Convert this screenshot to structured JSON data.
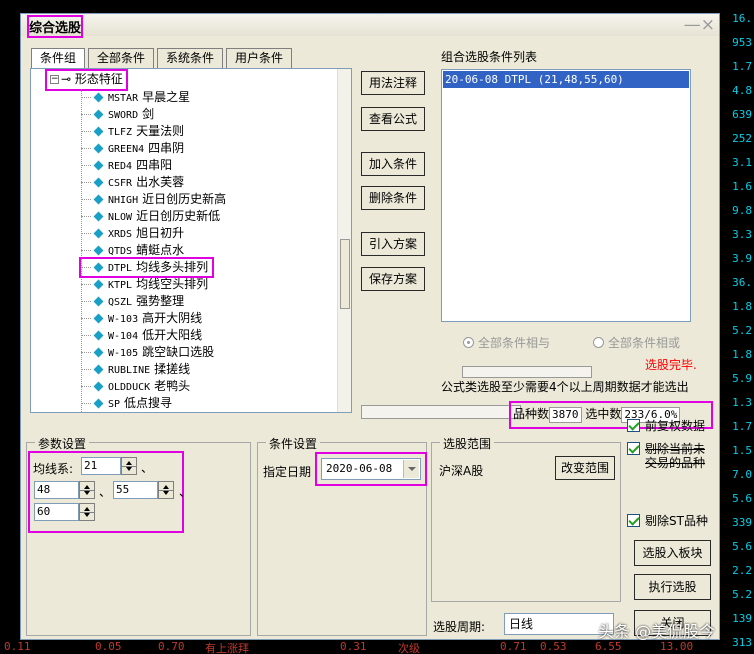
{
  "background": {
    "right_column": [
      "16.",
      "953",
      "1.7",
      "4.8",
      "639",
      "252",
      "3.1",
      "1.6",
      "9.8",
      "3.3",
      "3.9",
      "36.",
      "1.8",
      "5.2",
      "1.8",
      "5.9",
      "1.3",
      "1.7",
      "1.5",
      "7.0",
      "5.6",
      "339",
      "5.6",
      "2.2",
      "5.2",
      "139",
      "313"
    ],
    "bottom_row": [
      "0.11",
      "0.05",
      "0.70",
      "有上涨拜",
      "0.31",
      "次级",
      "0.71",
      "0.53",
      "6.55",
      "13.00"
    ]
  },
  "window": {
    "title": "综合选股",
    "close": "—×"
  },
  "tabs": [
    "条件组",
    "全部条件",
    "系统条件",
    "用户条件"
  ],
  "tree": {
    "root": "形态特征",
    "items": [
      {
        "code": "MSTAR",
        "label": "早晨之星"
      },
      {
        "code": "SWORD",
        "label": "剑"
      },
      {
        "code": "TLFZ",
        "label": "天量法则"
      },
      {
        "code": "GREEN4",
        "label": "四串阴"
      },
      {
        "code": "RED4",
        "label": "四串阳"
      },
      {
        "code": "CSFR",
        "label": "出水芙蓉"
      },
      {
        "code": "NHIGH",
        "label": "近日创历史新高"
      },
      {
        "code": "NLOW",
        "label": "近日创历史新低"
      },
      {
        "code": "XRDS",
        "label": "旭日初升"
      },
      {
        "code": "QTDS",
        "label": "蜻蜓点水"
      },
      {
        "code": "DTPL",
        "label": "均线多头排列"
      },
      {
        "code": "KTPL",
        "label": "均线空头排列"
      },
      {
        "code": "QSZL",
        "label": "强势整理"
      },
      {
        "code": "W-103",
        "label": "高开大阴线"
      },
      {
        "code": "W-104",
        "label": "低开大阳线"
      },
      {
        "code": "W-105",
        "label": "跳空缺口选股"
      },
      {
        "code": "RUBLINE",
        "label": "揉搓线"
      },
      {
        "code": "OLDDUCK",
        "label": "老鸭头"
      },
      {
        "code": "SP",
        "label": "低点搜寻"
      }
    ]
  },
  "buttons": {
    "usage_note": "用法注释",
    "view_formula": "查看公式",
    "add_condition": "加入条件",
    "delete_condition": "删除条件",
    "import_plan": "引入方案",
    "save_plan": "保存方案",
    "change_range": "改变范围",
    "to_block": "选股入板块",
    "execute": "执行选股",
    "close": "关闭"
  },
  "combo": {
    "label": "组合选股条件列表",
    "items": [
      "20-06-08 DTPL (21,48,55,60)"
    ]
  },
  "logic": {
    "and_label": "全部条件相与",
    "or_label": "全部条件相或"
  },
  "status": {
    "done": "选股完毕.",
    "note": "公式类选股至少需要4个以上周期数据才能选出",
    "count_label": "品种数",
    "count_value": "3870",
    "selected_label": "选中数",
    "selected_value": "233/6.0%"
  },
  "params": {
    "title": "参数设置",
    "ma_label": "均线系:",
    "v1": "21",
    "v2": "48",
    "v3": "55",
    "v4": "60",
    "sep": "、"
  },
  "condition": {
    "title": "条件设置",
    "date_label": "指定日期",
    "date_value": "2020-06-08"
  },
  "range": {
    "title": "选股范围",
    "value": "沪深A股"
  },
  "checks": {
    "pre_adjusted": "前复权数据",
    "exclude_untraded_1": "剔除当前未",
    "exclude_untraded_2": "交易的品种",
    "exclude_st": "剔除ST品种"
  },
  "period": {
    "label": "选股周期:",
    "value": "日线"
  },
  "watermark": "头条 @美侃股今"
}
